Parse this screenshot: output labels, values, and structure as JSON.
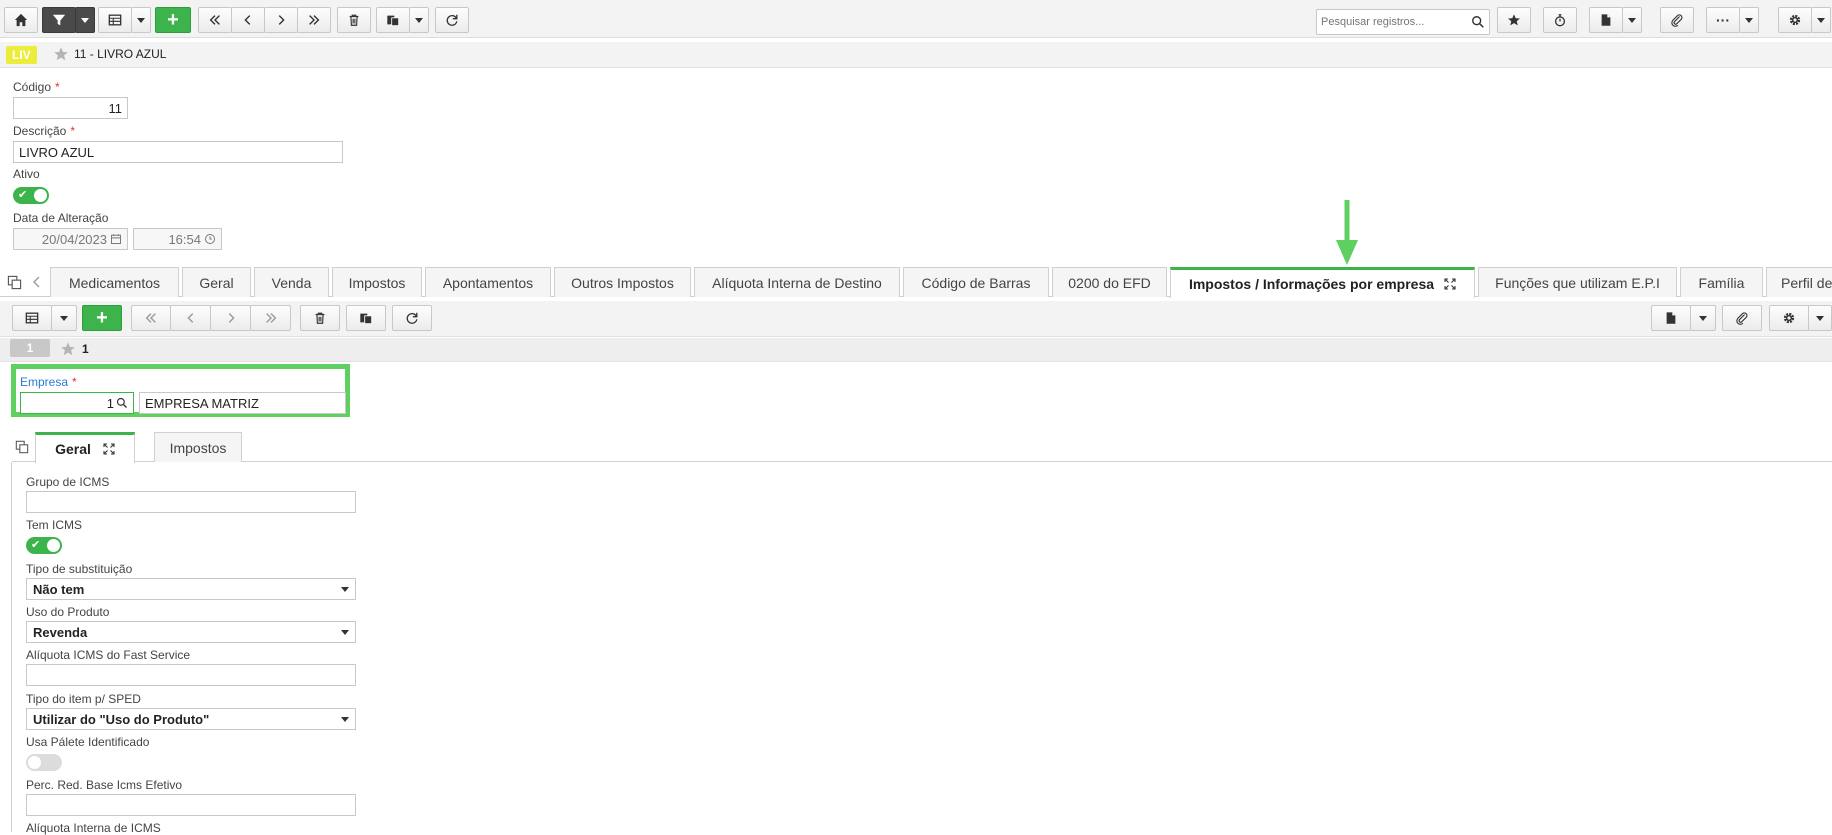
{
  "toolbar": {
    "search_placeholder": "Pesquisar registros..."
  },
  "record": {
    "badge": "LIV",
    "title": "11 - LIVRO AZUL"
  },
  "form": {
    "codigo_label": "Código",
    "codigo_value": "11",
    "descricao_label": "Descrição",
    "descricao_value": "LIVRO AZUL",
    "ativo_label": "Ativo",
    "ativo_on": true,
    "data_alteracao_label": "Data de Alteração",
    "data_value": "20/04/2023",
    "hora_value": "16:54",
    "required_mark": "*"
  },
  "tabs": [
    {
      "label": "Medicamentos"
    },
    {
      "label": "Geral"
    },
    {
      "label": "Venda"
    },
    {
      "label": "Impostos"
    },
    {
      "label": "Apontamentos"
    },
    {
      "label": "Outros Impostos"
    },
    {
      "label": "Alíquota Interna de Destino"
    },
    {
      "label": "Código de Barras"
    },
    {
      "label": "0200 do EFD"
    },
    {
      "label": "Impostos / Informações por empresa"
    },
    {
      "label": "Funções que utilizam E.P.I"
    },
    {
      "label": "Família"
    },
    {
      "label": "Perfil de"
    }
  ],
  "subrecord": {
    "badge": "1",
    "title": "1"
  },
  "empresa": {
    "label": "Empresa",
    "code": "1",
    "name": "EMPRESA MATRIZ"
  },
  "innertabs": [
    {
      "label": "Geral"
    },
    {
      "label": "Impostos"
    }
  ],
  "geral": {
    "grupo_icms_label": "Grupo de ICMS",
    "grupo_icms_value": "",
    "tem_icms_label": "Tem ICMS",
    "tem_icms_on": true,
    "tipo_subst_label": "Tipo de substituição",
    "tipo_subst_value": "Não tem",
    "uso_produto_label": "Uso do Produto",
    "uso_produto_value": "Revenda",
    "aliq_fast_label": "Alíquota ICMS do Fast Service",
    "aliq_fast_value": "",
    "tipo_item_label": "Tipo do item p/ SPED",
    "tipo_item_value": "Utilizar do \"Uso do Produto\"",
    "usa_palete_label": "Usa Pálete Identificado",
    "usa_palete_on": false,
    "perc_red_label": "Perc. Red. Base Icms Efetivo",
    "perc_red_value": "",
    "aliq_interna_label": "Alíquota Interna de ICMS"
  },
  "colors": {
    "accent": "#3cb44b",
    "highlight": "#5fcf5f",
    "badge_yellow": "#ecec3c",
    "required": "#e23232",
    "empresa_label": "#2a7ad1"
  }
}
